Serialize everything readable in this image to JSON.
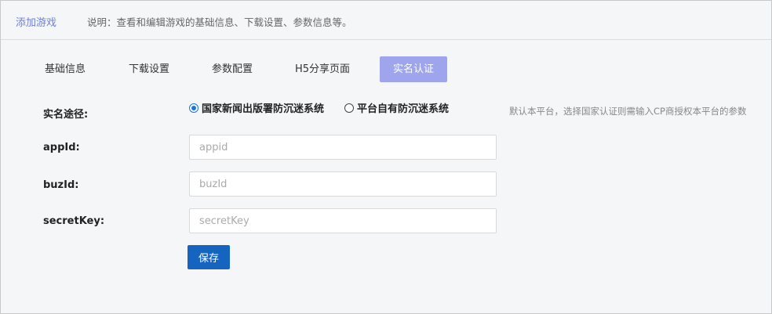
{
  "header": {
    "title": "添加游戏",
    "description": "说明：查看和编辑游戏的基础信息、下载设置、参数信息等。"
  },
  "tabs": [
    {
      "label": "基础信息",
      "active": false
    },
    {
      "label": "下载设置",
      "active": false
    },
    {
      "label": "参数配置",
      "active": false
    },
    {
      "label": "H5分享页面",
      "active": false
    },
    {
      "label": "实名认证",
      "active": true
    }
  ],
  "form": {
    "route_label": "实名途径:",
    "route_options": [
      {
        "label": "国家新闻出版署防沉迷系统",
        "checked": true
      },
      {
        "label": "平台自有防沉迷系统",
        "checked": false
      }
    ],
    "route_hint": "默认本平台，选择国家认证则需输入CP商授权本平台的参数",
    "appid_label": "appId:",
    "appid_placeholder": "appid",
    "appid_value": "",
    "buzid_label": "buzId:",
    "buzid_placeholder": "buzId",
    "buzid_value": "",
    "secretkey_label": "secretKey:",
    "secretkey_placeholder": "secretKey",
    "secretkey_value": "",
    "save_label": "保存"
  },
  "colors": {
    "accent": "#9ea5ec",
    "title": "#6f7fd8",
    "primary_button": "#1565c0",
    "radio_checked": "#1a73e8"
  }
}
